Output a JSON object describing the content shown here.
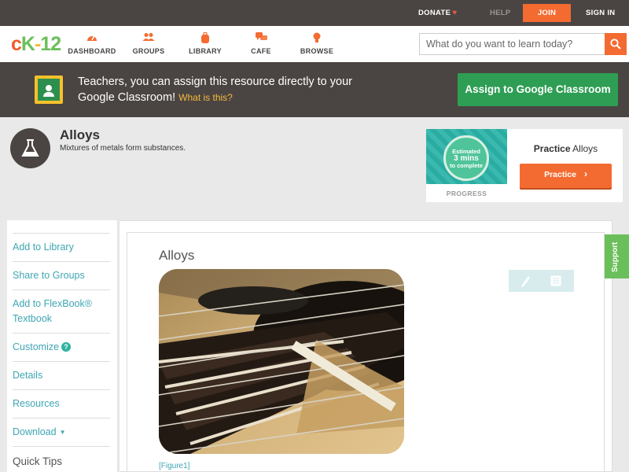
{
  "topbar": {
    "donate": "DONATE",
    "help": "HELP",
    "join": "JOIN",
    "signin": "SIGN IN"
  },
  "logo": {
    "c": "c",
    "k": "K",
    "dash": "-",
    "num": "12"
  },
  "nav": {
    "dashboard": "DASHBOARD",
    "groups": "GROUPS",
    "library": "LIBRARY",
    "cafe": "CAFE",
    "browse": "BROWSE"
  },
  "search": {
    "placeholder": "What do you want to learn today?"
  },
  "banner": {
    "text": "Teachers, you can assign this resource directly to your Google Classroom!",
    "link": "What is this?",
    "assign_button": "Assign to Google Classroom"
  },
  "concept": {
    "title": "Alloys",
    "subtitle": "Mixtures of metals form substances."
  },
  "practice_card": {
    "estimate_line1": "Estimated",
    "estimate_line2": "3 mins",
    "estimate_line3": "to complete",
    "progress_label": "PROGRESS",
    "heading_bold": "Practice",
    "heading_rest": "Alloys",
    "button": "Practice"
  },
  "sidebar": {
    "items": [
      {
        "label": "Add to Library"
      },
      {
        "label": "Share to Groups"
      },
      {
        "label": "Add to FlexBook® Textbook"
      },
      {
        "label": "Customize"
      },
      {
        "label": "Details"
      },
      {
        "label": "Resources"
      },
      {
        "label": "Download"
      }
    ],
    "quick_tips": "Quick Tips"
  },
  "article": {
    "title": "Alloys",
    "figure_caption": "[Figure1]"
  },
  "support": {
    "label": "Support"
  },
  "colors": {
    "accent_orange": "#f36b31",
    "accent_green": "#2e9e54",
    "link_teal": "#3ea6b4",
    "dark_bar": "#4a4542",
    "support_green": "#6bbf5b"
  },
  "icons": {
    "donate": "heart-icon",
    "dashboard": "gauge-icon",
    "groups": "people-icon",
    "library": "backpack-icon",
    "cafe": "chat-bubbles-icon",
    "browse": "lightbulb-icon",
    "search": "search-icon",
    "classroom": "google-classroom-icon",
    "concept": "flask-icon",
    "edit": "pencil-icon",
    "notes": "notes-icon"
  }
}
